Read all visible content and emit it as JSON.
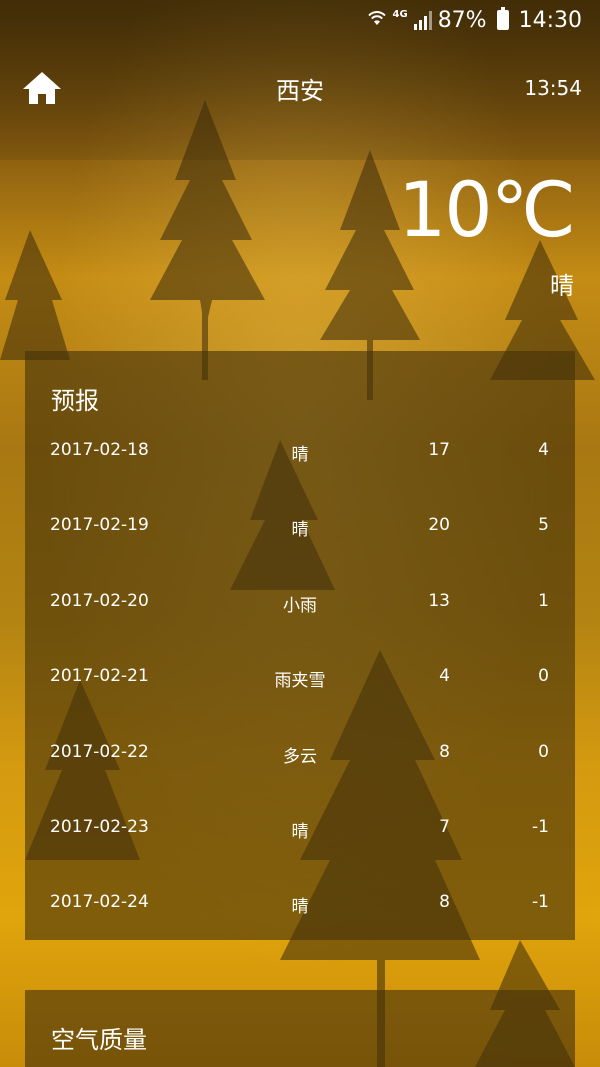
{
  "status_bar": {
    "network": "4G",
    "battery": "87%",
    "time": "14:30"
  },
  "header": {
    "city": "西安",
    "update_time": "13:54",
    "home_icon": "home-icon"
  },
  "current": {
    "temperature": "10℃",
    "condition": "晴"
  },
  "forecast": {
    "title": "预报",
    "rows": [
      {
        "date": "2017-02-18",
        "condition": "晴",
        "max": "17",
        "min": "4"
      },
      {
        "date": "2017-02-19",
        "condition": "晴",
        "max": "20",
        "min": "5"
      },
      {
        "date": "2017-02-20",
        "condition": "小雨",
        "max": "13",
        "min": "1"
      },
      {
        "date": "2017-02-21",
        "condition": "雨夹雪",
        "max": "4",
        "min": "0"
      },
      {
        "date": "2017-02-22",
        "condition": "多云",
        "max": "8",
        "min": "0"
      },
      {
        "date": "2017-02-23",
        "condition": "晴",
        "max": "7",
        "min": "-1"
      },
      {
        "date": "2017-02-24",
        "condition": "晴",
        "max": "8",
        "min": "-1"
      }
    ]
  },
  "air_quality": {
    "title": "空气质量"
  }
}
